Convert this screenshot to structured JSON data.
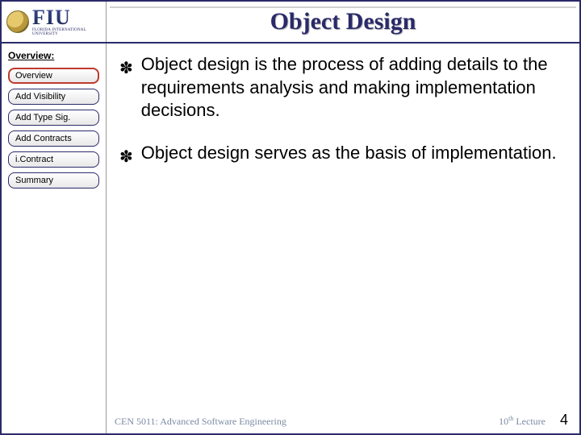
{
  "logo": {
    "big": "FIU",
    "small": "FLORIDA INTERNATIONAL UNIVERSITY"
  },
  "title": "Object Design",
  "sidebar": {
    "heading": "Overview:",
    "items": [
      {
        "label": "Overview",
        "active": true
      },
      {
        "label": "Add Visibility",
        "active": false
      },
      {
        "label": "Add Type Sig.",
        "active": false
      },
      {
        "label": "Add Contracts",
        "active": false
      },
      {
        "label": "i.Contract",
        "active": false
      },
      {
        "label": "Summary",
        "active": false
      }
    ]
  },
  "bullets": [
    "Object design is the process of adding details to the requirements analysis and making implementation decisions.",
    "Object design serves as the basis of implementation."
  ],
  "footer": {
    "course": "CEN 5011: Advanced Software Engineering",
    "lecture_ord": "10",
    "lecture_suffix": "th",
    "lecture_word": " Lecture",
    "page": "4"
  }
}
